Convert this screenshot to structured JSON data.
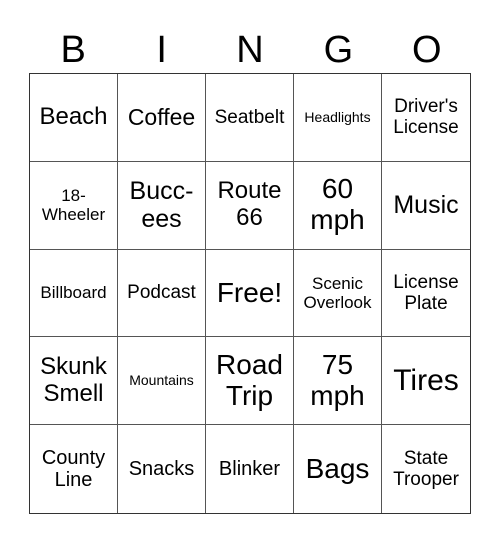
{
  "header": [
    "B",
    "I",
    "N",
    "G",
    "O"
  ],
  "cells": [
    "Beach",
    "Coffee",
    "Seatbelt",
    "Headlights",
    "Driver's License",
    "18-Wheeler",
    "Bucc-ees",
    "Route 66",
    "60 mph",
    "Music",
    "Billboard",
    "Podcast",
    "Free!",
    "Scenic Overlook",
    "License Plate",
    "Skunk Smell",
    "Mountains",
    "Road Trip",
    "75 mph",
    "Tires",
    "County Line",
    "Snacks",
    "Blinker",
    "Bags",
    "State Trooper"
  ]
}
